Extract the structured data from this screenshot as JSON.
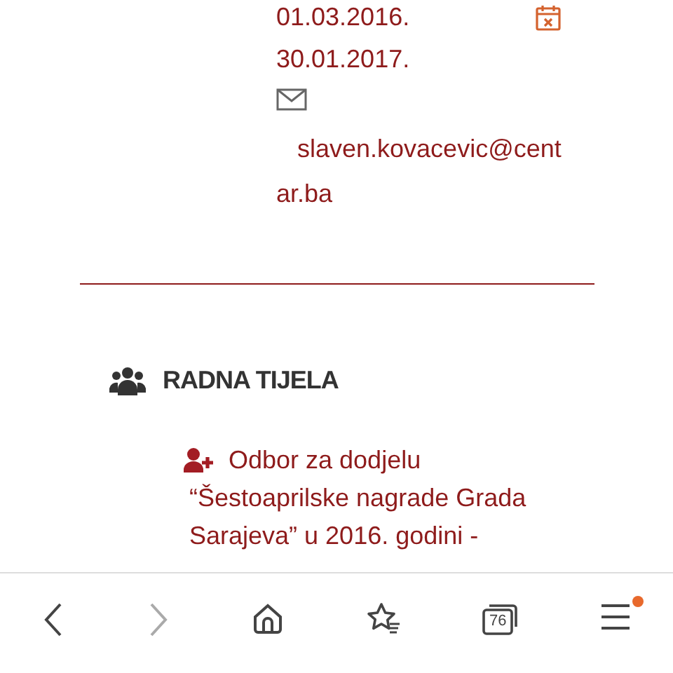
{
  "contact": {
    "dates": [
      "01.03.2016.",
      "30.01.2017."
    ],
    "email": "slaven.kovacevic@centar.ba"
  },
  "section": {
    "title": "RADNA TIJELA",
    "items": [
      {
        "text": "Odbor za dodjelu “Šestoaprilske nagrade Grada Sarajeva” u 2016. godini -"
      }
    ]
  },
  "toolbar": {
    "back": {
      "disabled": false
    },
    "forward": {
      "disabled": true
    },
    "tab_count": "76",
    "menu": {
      "notification": true
    }
  }
}
